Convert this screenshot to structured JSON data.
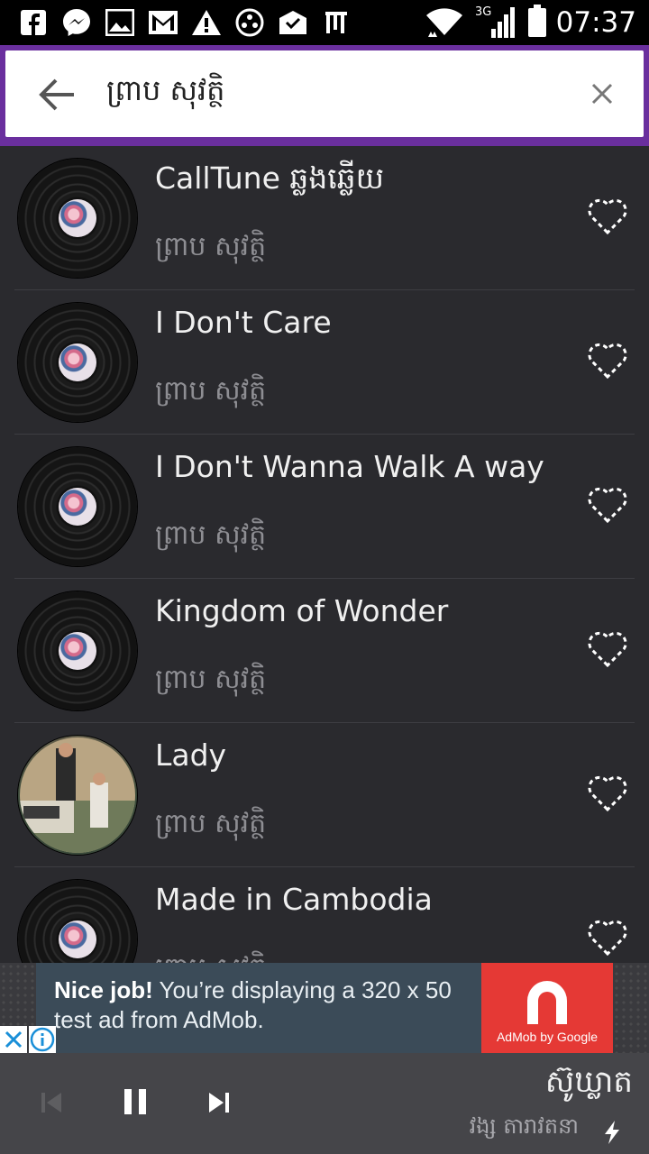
{
  "status_bar": {
    "time": "07:37",
    "network_label": "3G",
    "notification_icons": [
      "facebook-icon",
      "messenger-icon",
      "image-icon",
      "gmail-icon",
      "warning-icon",
      "game-icon",
      "mail-check-icon",
      "app-icon"
    ]
  },
  "search": {
    "query": "ព្រាប សុវត្ថិ"
  },
  "songs": [
    {
      "title": "CallTune ឆ្លងឆ្លើយ",
      "artist": "ព្រាប សុវត្ថិ",
      "art": "vinyl"
    },
    {
      "title": "I Don't Care",
      "artist": "ព្រាប សុវត្ថិ",
      "art": "vinyl"
    },
    {
      "title": "I Don't Wanna Walk A way",
      "artist": "ព្រាប សុវត្ថិ",
      "art": "vinyl"
    },
    {
      "title": "Kingdom of Wonder",
      "artist": "ព្រាប សុវត្ថិ",
      "art": "vinyl"
    },
    {
      "title": "Lady",
      "artist": "ព្រាប សុវត្ថិ",
      "art": "album-cover"
    },
    {
      "title": "Made in Cambodia",
      "artist": "ព្រាប សុវត្ថិ",
      "art": "vinyl"
    }
  ],
  "ad": {
    "headline": "Nice job!",
    "body": " You’re displaying a 320 x 50 test ad from AdMob.",
    "brand": "AdMob by Google"
  },
  "now_playing": {
    "title": "ស៊ូឃ្លាត",
    "artist": "វង្ស តារាវតនា"
  },
  "colors": {
    "header_accent": "#6a2f9e",
    "list_background": "#2a2a2e",
    "player_background": "#454549",
    "ad_red": "#e53935"
  }
}
